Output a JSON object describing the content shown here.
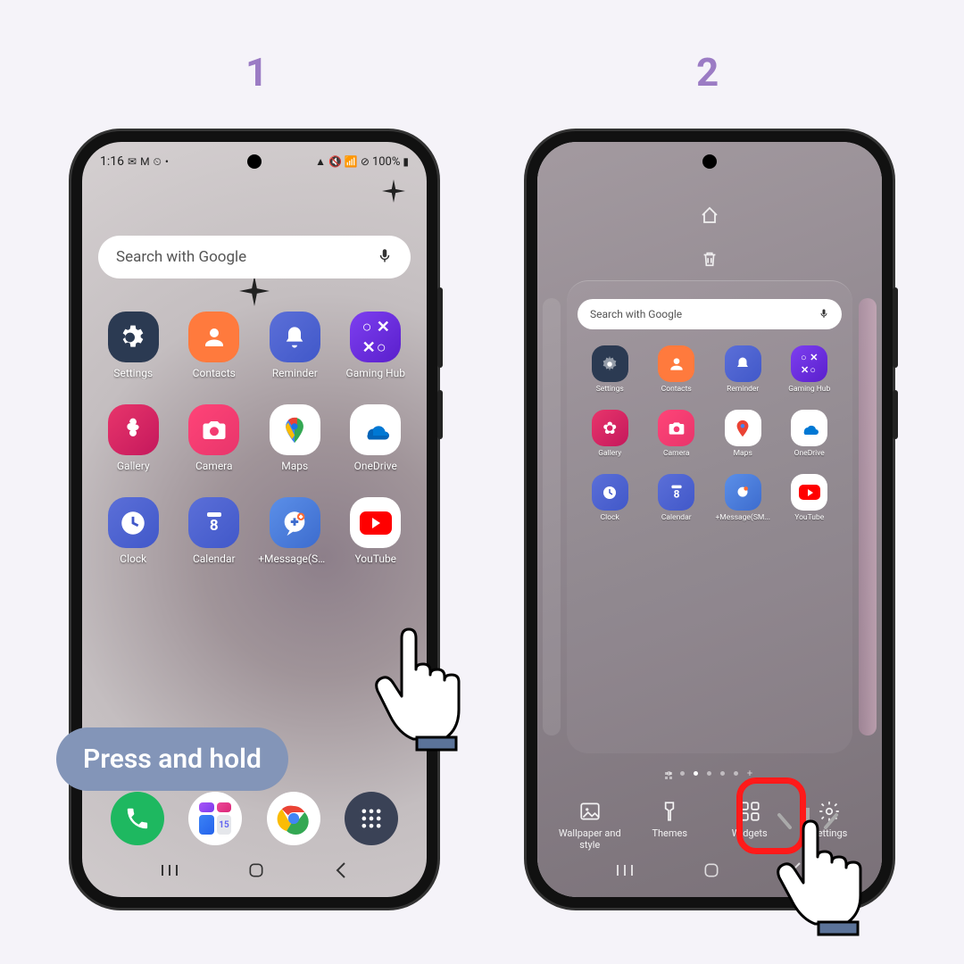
{
  "steps": {
    "one": "1",
    "two": "2"
  },
  "callout": {
    "text": "Press and hold"
  },
  "statusbar": {
    "time": "1:16",
    "battery": "100%"
  },
  "search": {
    "placeholder": "Search with Google"
  },
  "apps": {
    "settings": "Settings",
    "contacts": "Contacts",
    "reminder": "Reminder",
    "gaminghub": "Gaming Hub",
    "gallery": "Gallery",
    "camera": "Camera",
    "maps": "Maps",
    "onedrive": "OneDrive",
    "clock": "Clock",
    "calendar": "Calendar",
    "calendarDate": "8",
    "message": "+Message(SM...",
    "youtube": "YouTube"
  },
  "editbar": {
    "wallpaper": "Wallpaper and style",
    "themes": "Themes",
    "widgets": "Widgets",
    "settings": "Settings"
  }
}
